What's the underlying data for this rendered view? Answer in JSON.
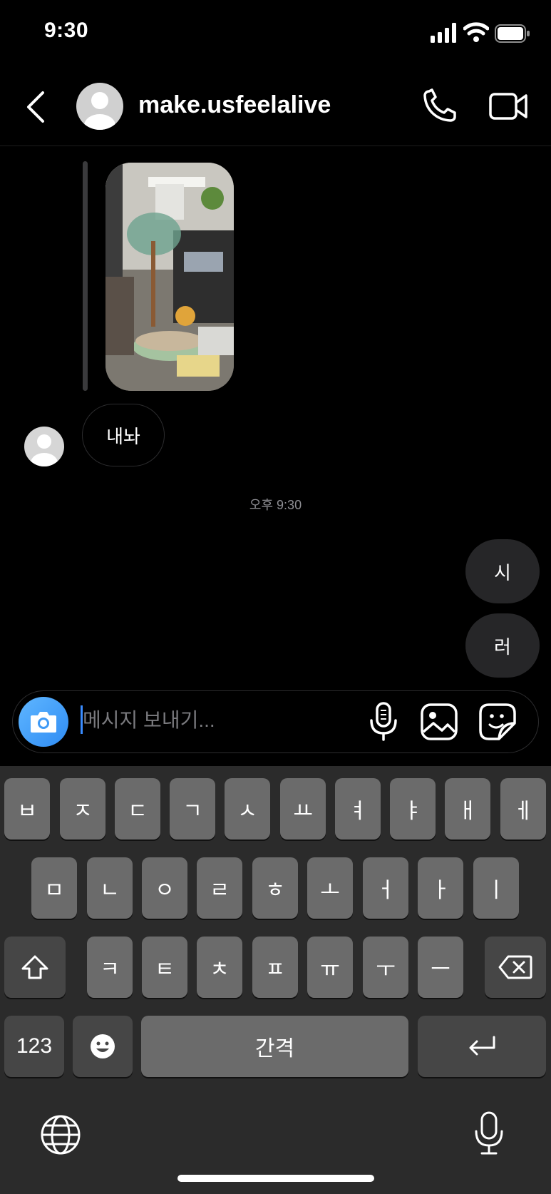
{
  "status_bar": {
    "time": "9:30"
  },
  "header": {
    "username": "make.usfeelalive"
  },
  "thread": {
    "received_message": "내놔",
    "timestamp": "오후 9:30",
    "sent_messages": [
      "시",
      "러"
    ]
  },
  "composer": {
    "placeholder": "메시지 보내기..."
  },
  "keyboard": {
    "row1": [
      "ㅂ",
      "ㅈ",
      "ㄷ",
      "ㄱ",
      "ㅅ",
      "ㅛ",
      "ㅕ",
      "ㅑ",
      "ㅐ",
      "ㅔ"
    ],
    "row2": [
      "ㅁ",
      "ㄴ",
      "ㅇ",
      "ㄹ",
      "ㅎ",
      "ㅗ",
      "ㅓ",
      "ㅏ",
      "ㅣ"
    ],
    "row3": [
      "ㅋ",
      "ㅌ",
      "ㅊ",
      "ㅍ",
      "ㅠ",
      "ㅜ",
      "ㅡ"
    ],
    "numbers_label": "123",
    "space_label": "간격"
  },
  "icons": {
    "status": [
      "signal-icon",
      "wifi-icon",
      "battery-icon"
    ],
    "header": [
      "back-icon",
      "phone-icon",
      "video-icon"
    ],
    "composer": [
      "camera-icon",
      "microphone-icon",
      "gallery-icon",
      "sticker-icon"
    ],
    "keyboard": [
      "shift-icon",
      "delete-icon",
      "emoji-icon",
      "return-icon",
      "globe-icon",
      "dictation-icon"
    ]
  },
  "colors": {
    "background": "#000000",
    "accent_blue": "#3797f0",
    "bubble": "#262628",
    "key": "#6b6b6b"
  }
}
